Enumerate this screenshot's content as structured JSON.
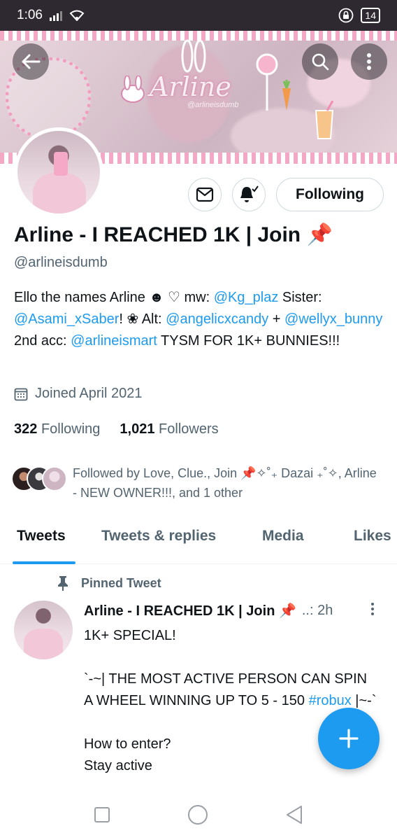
{
  "status_bar": {
    "time": "1:06",
    "battery": "14"
  },
  "banner": {
    "title": "Arline",
    "handle": "@arlineisdumb"
  },
  "profile": {
    "display_name": "Arline - I REACHED 1K | Join 📌",
    "handle": "@arlineisdumb",
    "following_button": "Following",
    "bio": {
      "t1": "Ello the names Arline ☻ ♡ mw: ",
      "l1": "@Kg_plaz",
      "t2": " Sister: ",
      "l2": "@Asami_xSaber",
      "t3": "! ❀ Alt: ",
      "l3": "@angelicxcandy",
      "t4": " + ",
      "l4": "@wellyx_bunny",
      "t5": " 2nd acc: ",
      "l5": "@arlineismart",
      "t6": "  TYSM FOR 1K+ BUNNIES!!!"
    },
    "joined": "Joined April 2021",
    "following_count": "322",
    "following_label": "Following",
    "followers_count": "1,021",
    "followers_label": "Followers",
    "followed_by": "Followed by Love, Clue., Join 📌✧˚₊ Dazai ₊˚✧, Arline - NEW OWNER!!!, and 1 other"
  },
  "tabs": [
    {
      "label": "Tweets"
    },
    {
      "label": "Tweets & replies"
    },
    {
      "label": "Media"
    },
    {
      "label": "Likes"
    }
  ],
  "tweet": {
    "pinned_label": "Pinned Tweet",
    "author": "Arline - I REACHED 1K | Join 📌",
    "meta": "..: 2h",
    "line1": "1K+ SPECIAL!",
    "line2": "`-~| THE MOST ACTIVE PERSON CAN SPIN A WHEEL WINNING UP TO  5 - 150 ",
    "hashtag": "#robux",
    "line3": " |~-`",
    "line4": "How to enter?",
    "line5": "Stay active"
  },
  "colors": {
    "accent": "#1d9bf0",
    "secondary_text": "#536471",
    "banner_pink": "#f3a9c6"
  },
  "icons": {
    "back": "arrow-left-icon",
    "search": "search-icon",
    "more": "more-vertical-icon",
    "message": "envelope-icon",
    "notify": "bell-check-icon",
    "calendar": "calendar-icon",
    "pin": "pin-icon",
    "compose": "plus-icon"
  }
}
